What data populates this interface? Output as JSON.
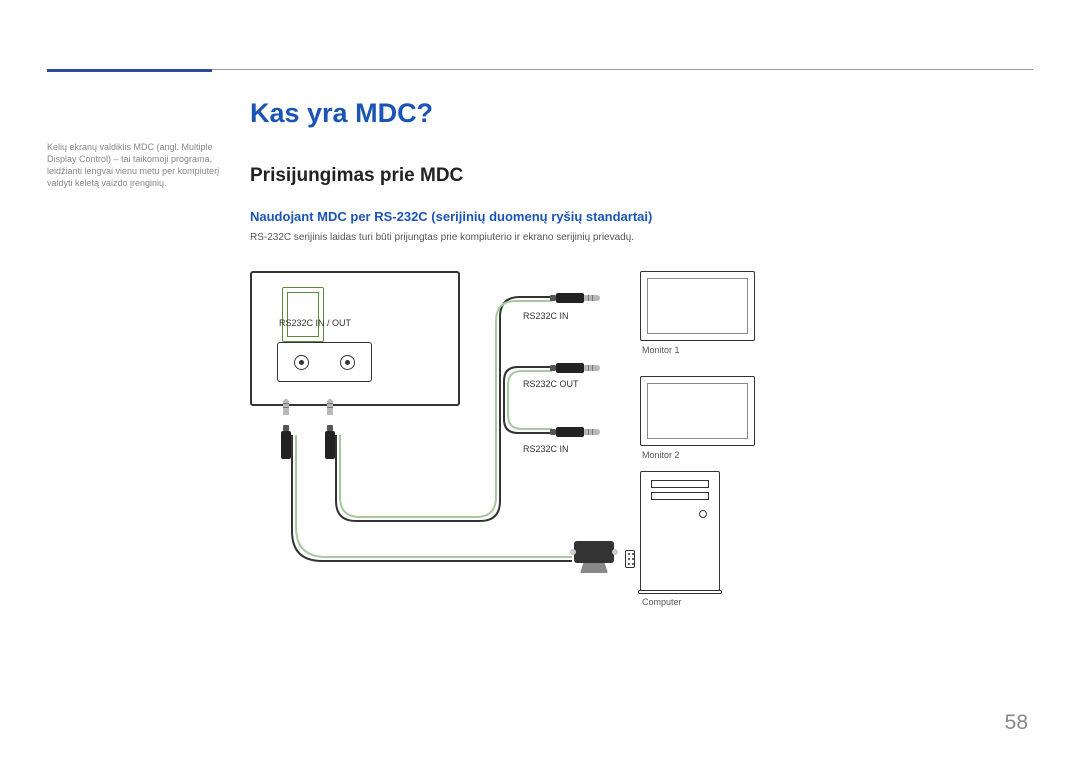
{
  "sidebar": {
    "note": "Kelių ekranų valdiklis MDC (angl. Multiple Display Control) – tai taikomoji programa, leidžianti lengvai vienu metu per kompiuterį valdyti keletą vaizdo įrenginių."
  },
  "main": {
    "title": "Kas yra MDC?",
    "section": "Prisijungimas prie MDC",
    "subsection": "Naudojant MDC per RS-232C (serijinių duomenų ryšių standartai)",
    "body": "RS-232C serijinis laidas turi būti prijungtas prie kompiuterio ir ekrano serijinių prievadų."
  },
  "diagram": {
    "port_label": "RS232C IN / OUT",
    "in1": "RS232C IN",
    "out": "RS232C OUT",
    "in2": "RS232C IN",
    "monitor1": "Monitor 1",
    "monitor2": "Monitor 2",
    "computer": "Computer"
  },
  "page": "58"
}
